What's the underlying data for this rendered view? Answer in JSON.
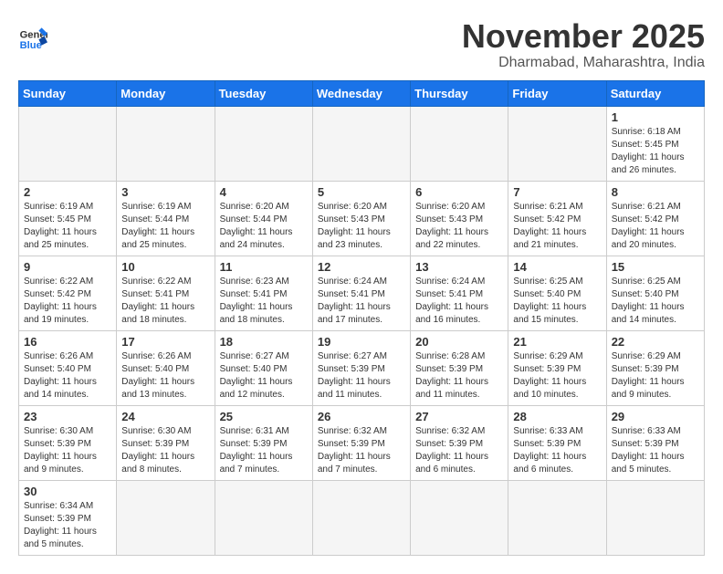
{
  "logo": {
    "general": "General",
    "blue": "Blue"
  },
  "title": "November 2025",
  "subtitle": "Dharmabad, Maharashtra, India",
  "weekdays": [
    "Sunday",
    "Monday",
    "Tuesday",
    "Wednesday",
    "Thursday",
    "Friday",
    "Saturday"
  ],
  "weeks": [
    [
      {
        "day": "",
        "info": ""
      },
      {
        "day": "",
        "info": ""
      },
      {
        "day": "",
        "info": ""
      },
      {
        "day": "",
        "info": ""
      },
      {
        "day": "",
        "info": ""
      },
      {
        "day": "",
        "info": ""
      },
      {
        "day": "1",
        "info": "Sunrise: 6:18 AM\nSunset: 5:45 PM\nDaylight: 11 hours\nand 26 minutes."
      }
    ],
    [
      {
        "day": "2",
        "info": "Sunrise: 6:19 AM\nSunset: 5:45 PM\nDaylight: 11 hours\nand 25 minutes."
      },
      {
        "day": "3",
        "info": "Sunrise: 6:19 AM\nSunset: 5:44 PM\nDaylight: 11 hours\nand 25 minutes."
      },
      {
        "day": "4",
        "info": "Sunrise: 6:20 AM\nSunset: 5:44 PM\nDaylight: 11 hours\nand 24 minutes."
      },
      {
        "day": "5",
        "info": "Sunrise: 6:20 AM\nSunset: 5:43 PM\nDaylight: 11 hours\nand 23 minutes."
      },
      {
        "day": "6",
        "info": "Sunrise: 6:20 AM\nSunset: 5:43 PM\nDaylight: 11 hours\nand 22 minutes."
      },
      {
        "day": "7",
        "info": "Sunrise: 6:21 AM\nSunset: 5:42 PM\nDaylight: 11 hours\nand 21 minutes."
      },
      {
        "day": "8",
        "info": "Sunrise: 6:21 AM\nSunset: 5:42 PM\nDaylight: 11 hours\nand 20 minutes."
      }
    ],
    [
      {
        "day": "9",
        "info": "Sunrise: 6:22 AM\nSunset: 5:42 PM\nDaylight: 11 hours\nand 19 minutes."
      },
      {
        "day": "10",
        "info": "Sunrise: 6:22 AM\nSunset: 5:41 PM\nDaylight: 11 hours\nand 18 minutes."
      },
      {
        "day": "11",
        "info": "Sunrise: 6:23 AM\nSunset: 5:41 PM\nDaylight: 11 hours\nand 18 minutes."
      },
      {
        "day": "12",
        "info": "Sunrise: 6:24 AM\nSunset: 5:41 PM\nDaylight: 11 hours\nand 17 minutes."
      },
      {
        "day": "13",
        "info": "Sunrise: 6:24 AM\nSunset: 5:41 PM\nDaylight: 11 hours\nand 16 minutes."
      },
      {
        "day": "14",
        "info": "Sunrise: 6:25 AM\nSunset: 5:40 PM\nDaylight: 11 hours\nand 15 minutes."
      },
      {
        "day": "15",
        "info": "Sunrise: 6:25 AM\nSunset: 5:40 PM\nDaylight: 11 hours\nand 14 minutes."
      }
    ],
    [
      {
        "day": "16",
        "info": "Sunrise: 6:26 AM\nSunset: 5:40 PM\nDaylight: 11 hours\nand 14 minutes."
      },
      {
        "day": "17",
        "info": "Sunrise: 6:26 AM\nSunset: 5:40 PM\nDaylight: 11 hours\nand 13 minutes."
      },
      {
        "day": "18",
        "info": "Sunrise: 6:27 AM\nSunset: 5:40 PM\nDaylight: 11 hours\nand 12 minutes."
      },
      {
        "day": "19",
        "info": "Sunrise: 6:27 AM\nSunset: 5:39 PM\nDaylight: 11 hours\nand 11 minutes."
      },
      {
        "day": "20",
        "info": "Sunrise: 6:28 AM\nSunset: 5:39 PM\nDaylight: 11 hours\nand 11 minutes."
      },
      {
        "day": "21",
        "info": "Sunrise: 6:29 AM\nSunset: 5:39 PM\nDaylight: 11 hours\nand 10 minutes."
      },
      {
        "day": "22",
        "info": "Sunrise: 6:29 AM\nSunset: 5:39 PM\nDaylight: 11 hours\nand 9 minutes."
      }
    ],
    [
      {
        "day": "23",
        "info": "Sunrise: 6:30 AM\nSunset: 5:39 PM\nDaylight: 11 hours\nand 9 minutes."
      },
      {
        "day": "24",
        "info": "Sunrise: 6:30 AM\nSunset: 5:39 PM\nDaylight: 11 hours\nand 8 minutes."
      },
      {
        "day": "25",
        "info": "Sunrise: 6:31 AM\nSunset: 5:39 PM\nDaylight: 11 hours\nand 7 minutes."
      },
      {
        "day": "26",
        "info": "Sunrise: 6:32 AM\nSunset: 5:39 PM\nDaylight: 11 hours\nand 7 minutes."
      },
      {
        "day": "27",
        "info": "Sunrise: 6:32 AM\nSunset: 5:39 PM\nDaylight: 11 hours\nand 6 minutes."
      },
      {
        "day": "28",
        "info": "Sunrise: 6:33 AM\nSunset: 5:39 PM\nDaylight: 11 hours\nand 6 minutes."
      },
      {
        "day": "29",
        "info": "Sunrise: 6:33 AM\nSunset: 5:39 PM\nDaylight: 11 hours\nand 5 minutes."
      }
    ],
    [
      {
        "day": "30",
        "info": "Sunrise: 6:34 AM\nSunset: 5:39 PM\nDaylight: 11 hours\nand 5 minutes."
      },
      {
        "day": "",
        "info": ""
      },
      {
        "day": "",
        "info": ""
      },
      {
        "day": "",
        "info": ""
      },
      {
        "day": "",
        "info": ""
      },
      {
        "day": "",
        "info": ""
      },
      {
        "day": "",
        "info": ""
      }
    ]
  ]
}
